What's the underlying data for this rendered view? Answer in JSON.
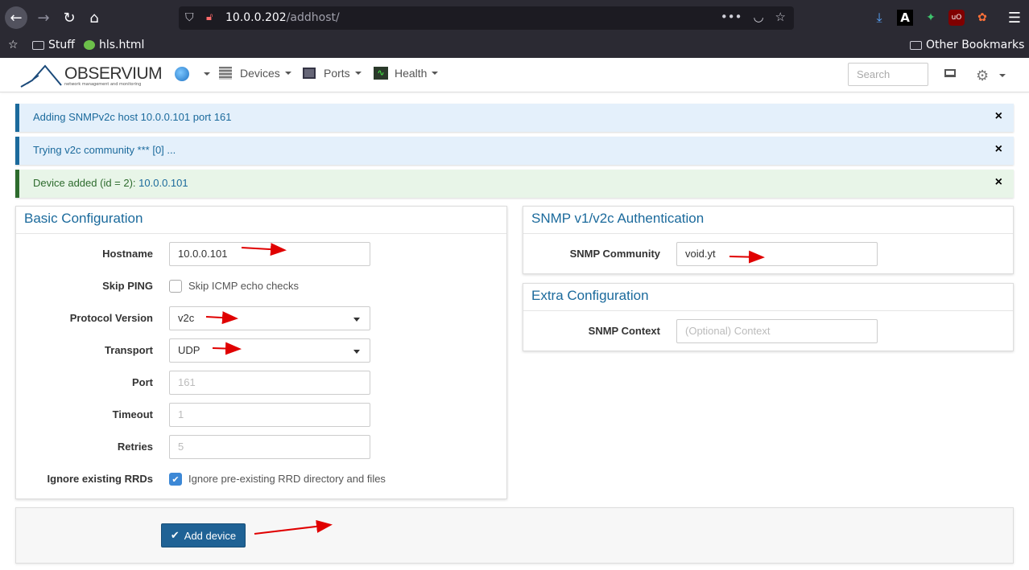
{
  "browser": {
    "url_host": "10.0.0.202",
    "url_path": "/addhost/",
    "bookmarks": [
      {
        "label": "Stuff"
      },
      {
        "label": "hls.html"
      }
    ],
    "other_bookmarks": "Other Bookmarks"
  },
  "nav": {
    "logo_text": "OBSERVIUM",
    "logo_sub": "network management and monitoring",
    "items": [
      {
        "label": "Devices"
      },
      {
        "label": "Ports"
      },
      {
        "label": "Health"
      }
    ],
    "search_placeholder": "Search"
  },
  "alerts": [
    {
      "text": "Adding SNMPv2c host 10.0.0.101 port 161",
      "close": "×"
    },
    {
      "text": "Trying v2c community *** [0] ...",
      "close": "×"
    },
    {
      "text_prefix": "Device added (id = 2): ",
      "text_id": "10.0.0.101",
      "close": "×"
    }
  ],
  "basic": {
    "title": "Basic Configuration",
    "hostname_label": "Hostname",
    "hostname_value": "10.0.0.101",
    "skip_ping_label": "Skip PING",
    "skip_ping_text": "Skip ICMP echo checks",
    "protocol_label": "Protocol Version",
    "protocol_value": "v2c",
    "transport_label": "Transport",
    "transport_value": "UDP",
    "port_label": "Port",
    "port_placeholder": "161",
    "timeout_label": "Timeout",
    "timeout_placeholder": "1",
    "retries_label": "Retries",
    "retries_placeholder": "5",
    "ignore_label": "Ignore existing RRDs",
    "ignore_text": "Ignore pre-existing RRD directory and files"
  },
  "snmp": {
    "title": "SNMP v1/v2c Authentication",
    "community_label": "SNMP Community",
    "community_value": "void.yt"
  },
  "extra": {
    "title": "Extra Configuration",
    "context_label": "SNMP Context",
    "context_placeholder": "(Optional) Context"
  },
  "actions": {
    "add_label": "Add device"
  },
  "colors": {
    "accent": "#1b6a9c",
    "success": "#2d6b2d",
    "annotation_arrow": "#e00000"
  }
}
